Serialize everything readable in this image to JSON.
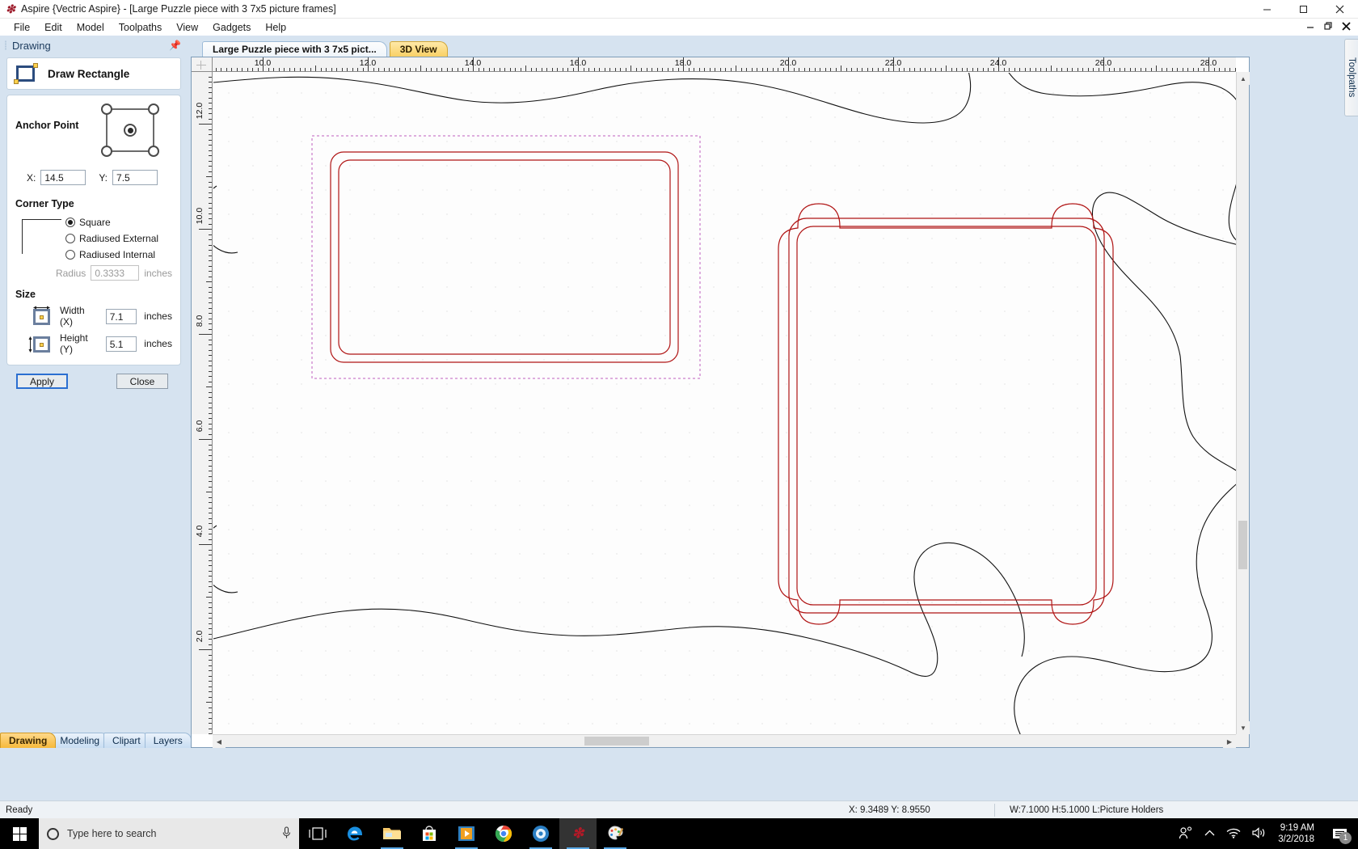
{
  "window": {
    "title": "Aspire {Vectric Aspire} - [Large Puzzle piece with 3 7x5 picture frames]",
    "app_icon": "aspire-flame-icon",
    "minimize": "–",
    "maximize": "❐",
    "close": "✕",
    "doc_minimize": "–",
    "doc_restore": "❐",
    "doc_close": "✕"
  },
  "menu": {
    "items": [
      "File",
      "Edit",
      "Model",
      "Toolpaths",
      "View",
      "Gadgets",
      "Help"
    ]
  },
  "left_panel": {
    "caption": "Drawing",
    "pin_icon": "pin-icon",
    "tool_title": "Draw Rectangle",
    "anchor": {
      "label": "Anchor Point",
      "x_label": "X:",
      "x_value": "14.5",
      "y_label": "Y:",
      "y_value": "7.5",
      "selected_node": "center"
    },
    "corner_type": {
      "label": "Corner Type",
      "options": [
        "Square",
        "Radiused External",
        "Radiused Internal"
      ],
      "selected": "Square",
      "radius_label": "Radius",
      "radius_value": "0.3333",
      "radius_unit": "inches"
    },
    "size": {
      "label": "Size",
      "width_label": "Width (X)",
      "width_value": "7.1",
      "width_unit": "inches",
      "height_label": "Height (Y)",
      "height_value": "5.1",
      "height_unit": "inches"
    },
    "buttons": {
      "apply": "Apply",
      "close": "Close"
    },
    "tabs": [
      "Drawing",
      "Modeling",
      "Clipart",
      "Layers"
    ],
    "active_tab": "Drawing"
  },
  "doc_tabs": {
    "items": [
      "Large Puzzle piece with 3 7x5 pict...",
      "3D View"
    ],
    "active": "Large Puzzle piece with 3 7x5 pict..."
  },
  "right_dock": {
    "label": "Toolpaths"
  },
  "rulers": {
    "horizontal_labels": [
      "10.0",
      "12.0",
      "14.0",
      "16.0",
      "18.0",
      "20.0",
      "22.0",
      "24.0",
      "26.0",
      "28.0"
    ],
    "vertical_labels": [
      "12.0",
      "10.0",
      "8.0",
      "6.0",
      "4.0",
      "2.0"
    ],
    "units": "inches"
  },
  "status_bar": {
    "ready": "Ready",
    "coords": "X:  9.3489 Y:  8.9550",
    "dims": "W:7.1000   H:5.1000  L:Picture Holders"
  },
  "taskbar": {
    "search_placeholder": "Type here to search",
    "search_icon": "search-circle-icon",
    "mic_icon": "microphone-icon",
    "start_icon": "windows-start-icon",
    "pinned": [
      {
        "name": "task-view-icon"
      },
      {
        "name": "edge-icon"
      },
      {
        "name": "file-explorer-icon"
      },
      {
        "name": "microsoft-store-icon"
      },
      {
        "name": "media-player-icon"
      },
      {
        "name": "chrome-icon"
      },
      {
        "name": "media-center-icon"
      },
      {
        "name": "aspire-icon"
      },
      {
        "name": "paint-icon"
      }
    ],
    "tray": [
      {
        "name": "people-icon"
      },
      {
        "name": "show-hidden-icons-chevron"
      },
      {
        "name": "wifi-icon"
      },
      {
        "name": "volume-icon"
      }
    ],
    "time": "9:19 AM",
    "date": "3/2/2018",
    "notification_icon": "action-center-icon",
    "notification_count": "1"
  },
  "colors": {
    "accent_blue": "#2b6fd1",
    "tab_yellow": "#f6b93b",
    "geometry_red": "#b01414",
    "selection_magenta": "#c060c0",
    "panel_blue": "#d6e3f0"
  }
}
